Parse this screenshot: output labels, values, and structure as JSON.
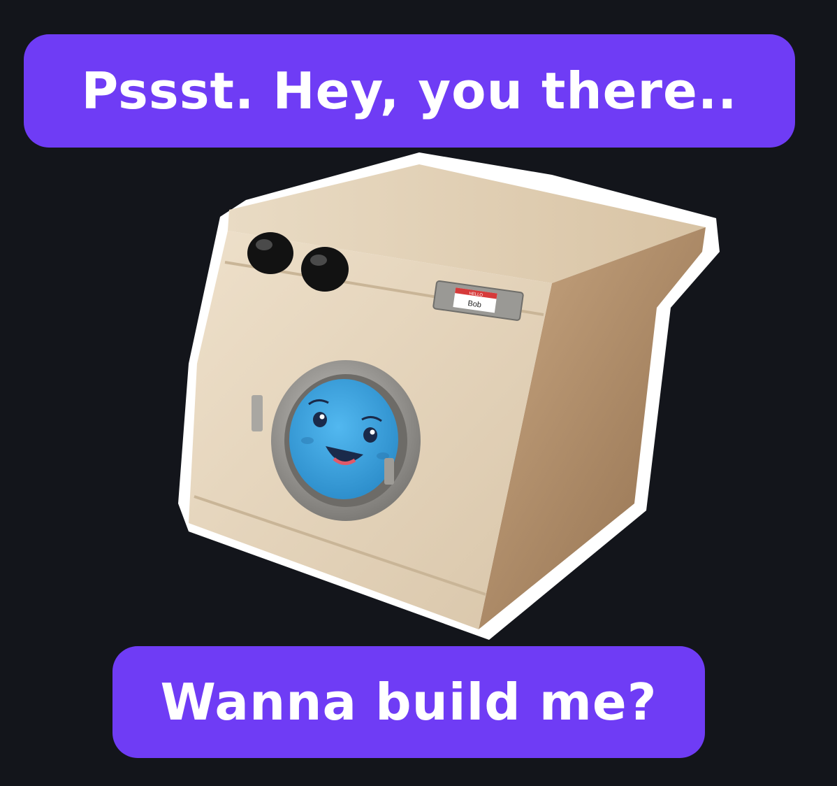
{
  "speech": {
    "top": "Pssst. Hey, you there..",
    "bottom": "Wanna build me?"
  },
  "machine": {
    "name_tag_header": "HELLO",
    "name_tag_name": "Bob"
  },
  "colors": {
    "background": "#13151b",
    "bubble": "#6f3cf5",
    "bubble_text": "#ffffff",
    "machine_front": "#e6d5bd",
    "machine_side": "#b08e68",
    "face": "#3aa7e4"
  }
}
